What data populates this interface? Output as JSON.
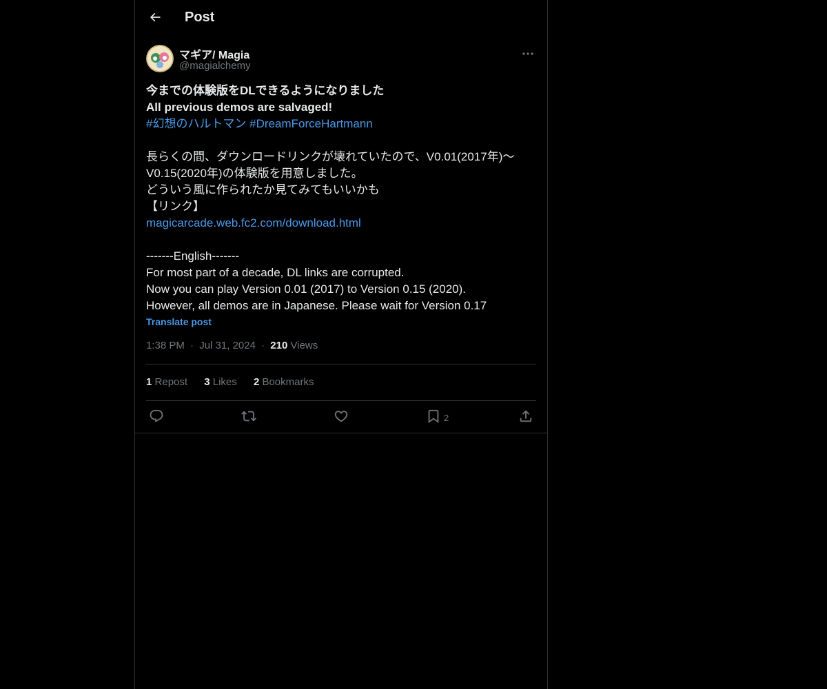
{
  "header": {
    "title": "Post"
  },
  "post": {
    "author_name": "マギア/ Magia",
    "author_handle": "@magialchemy",
    "lines": [
      {
        "text": "今までの体験版をDLできるようになりました",
        "style": "bold"
      },
      {
        "text": "All previous demos are salvaged!",
        "style": "bold"
      },
      {
        "text": "#幻想のハルトマン #DreamForceHartmann",
        "style": "link"
      },
      {
        "text": "",
        "style": "plain"
      },
      {
        "text": "長らくの間、ダウンロードリンクが壊れていたので、V0.01(2017年)〜",
        "style": "plain"
      },
      {
        "text": "V0.15(2020年)の体験版を用意しました。",
        "style": "plain"
      },
      {
        "text": "どういう風に作られたか見てみてもいいかも",
        "style": "plain"
      },
      {
        "text": "【リンク】",
        "style": "plain"
      },
      {
        "text": "magicarcade.web.fc2.com/download.html",
        "style": "link"
      },
      {
        "text": "",
        "style": "plain"
      },
      {
        "text": "-------English-------",
        "style": "plain"
      },
      {
        "text": "For most part of a decade, DL links are corrupted.",
        "style": "plain"
      },
      {
        "text": "Now you can play Version 0.01 (2017) to Version 0.15 (2020).",
        "style": "plain"
      },
      {
        "text": "However, all demos are in Japanese. Please wait for Version 0.17",
        "style": "plain"
      }
    ],
    "translate_label": "Translate post",
    "time": "1:38 PM",
    "date": "Jul 31, 2024",
    "views_count": "210",
    "views_label": "Views",
    "separator": "·"
  },
  "stats": {
    "reposts_count": "1",
    "reposts_label": "Repost",
    "likes_count": "3",
    "likes_label": "Likes",
    "bookmarks_count": "2",
    "bookmarks_label": "Bookmarks"
  },
  "actions": {
    "reply_icon": "reply-icon",
    "repost_icon": "repost-icon",
    "like_icon": "heart-icon",
    "bookmark_icon": "bookmark-icon",
    "bookmark_count": "2",
    "share_icon": "share-icon"
  },
  "colors": {
    "background": "#000000",
    "text": "#e7e9ea",
    "muted": "#71767b",
    "link": "#4a99e9",
    "border": "#2f3336"
  }
}
